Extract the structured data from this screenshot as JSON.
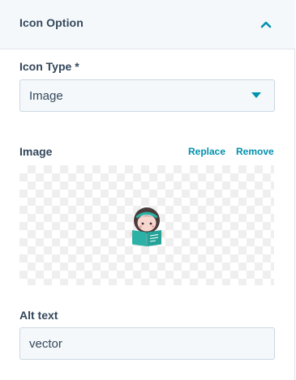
{
  "section": {
    "title": "Icon Option",
    "collapse_icon": "chevron-up-icon"
  },
  "icon_type": {
    "label": "Icon Type *",
    "value": "Image",
    "caret_icon": "caret-down-icon"
  },
  "image": {
    "label": "Image",
    "replace_label": "Replace",
    "remove_label": "Remove",
    "preview_icon": "reader-with-book-icon"
  },
  "alt_text": {
    "label": "Alt text",
    "value": "vector"
  },
  "colors": {
    "accent": "#0091ae",
    "text": "#33475b",
    "border": "#cbd6e2",
    "field_bg": "#f5f8fa"
  }
}
